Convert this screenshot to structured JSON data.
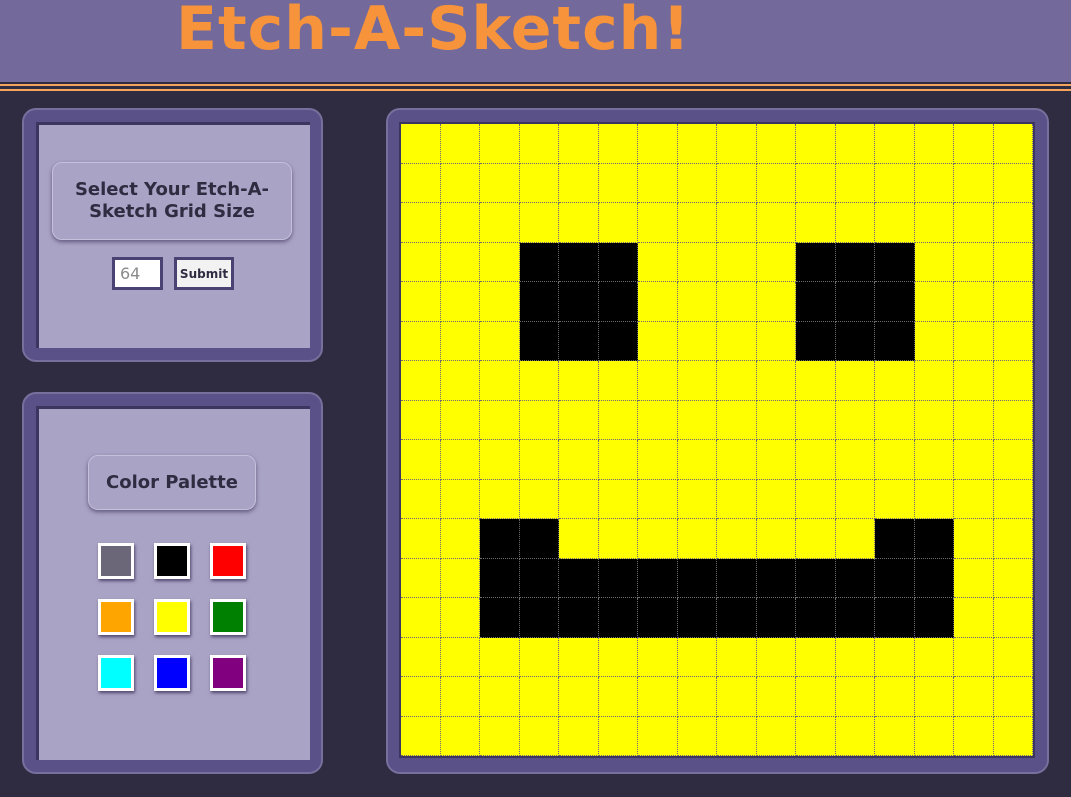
{
  "header": {
    "title": "Etch-A-Sketch!"
  },
  "size_panel": {
    "heading": "Select Your Etch-A-Sketch Grid Size",
    "input_placeholder": "64",
    "submit_label": "Submit"
  },
  "palette_panel": {
    "heading": "Color Palette",
    "swatches": [
      {
        "name": "gray",
        "color": "#6b6678"
      },
      {
        "name": "black",
        "color": "#000000"
      },
      {
        "name": "red",
        "color": "#ff0000"
      },
      {
        "name": "orange",
        "color": "#ffa500"
      },
      {
        "name": "yellow",
        "color": "#ffff00"
      },
      {
        "name": "green",
        "color": "#008000"
      },
      {
        "name": "cyan",
        "color": "#00ffff"
      },
      {
        "name": "blue",
        "color": "#0000ff"
      },
      {
        "name": "purple",
        "color": "#800080"
      }
    ]
  },
  "canvas": {
    "rows": 16,
    "cols": 16,
    "base_color": "#ffff00",
    "ink_color": "#000000",
    "pixels": [
      "................",
      "................",
      "................",
      "...XXX....XXX...",
      "...XXX....XXX...",
      "...XXX....XXX...",
      "................",
      "................",
      "................",
      "................",
      "..XX........XX..",
      "..XXXXXXXXXXXX..",
      "..XXXXXXXXXXXX..",
      "................",
      "................",
      "................"
    ]
  }
}
